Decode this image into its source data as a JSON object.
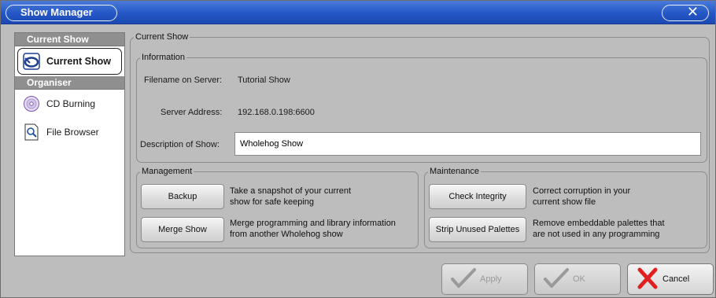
{
  "window": {
    "title": "Show Manager",
    "close_glyph": "✕"
  },
  "sidebar": {
    "section_current": "Current Show",
    "section_organiser": "Organiser",
    "items": [
      {
        "label": "Current Show",
        "icon": "current-show-icon"
      },
      {
        "label": "CD Burning",
        "icon": "cd-icon"
      },
      {
        "label": "File Browser",
        "icon": "file-browser-icon"
      }
    ]
  },
  "main": {
    "group_title": "Current Show",
    "information": {
      "title": "Information",
      "filename_label": "Filename on Server:",
      "filename_value": "Tutorial Show",
      "server_label": "Server Address:",
      "server_value": "192.168.0.198:6600",
      "description_label": "Description of Show:",
      "description_value": "Wholehog Show"
    },
    "management": {
      "title": "Management",
      "backup_label": "Backup",
      "backup_desc_1": "Take a snapshot of your current",
      "backup_desc_2": "show for safe keeping",
      "merge_label": "Merge Show",
      "merge_desc_1": "Merge programming and library information",
      "merge_desc_2": "from another Wholehog show"
    },
    "maintenance": {
      "title": "Maintenance",
      "check_label": "Check Integrity",
      "check_desc_1": "Correct corruption in your",
      "check_desc_2": "current show file",
      "strip_label": "Strip Unused Palettes",
      "strip_desc_1": "Remove embeddable palettes that",
      "strip_desc_2": "are not used in any programming"
    }
  },
  "footer": {
    "apply_label": "Apply",
    "ok_label": "OK",
    "cancel_label": "Cancel"
  },
  "colors": {
    "titlebar": "#2457c7",
    "cancel_x": "#e02020",
    "check_gray": "#9a9a9a"
  }
}
